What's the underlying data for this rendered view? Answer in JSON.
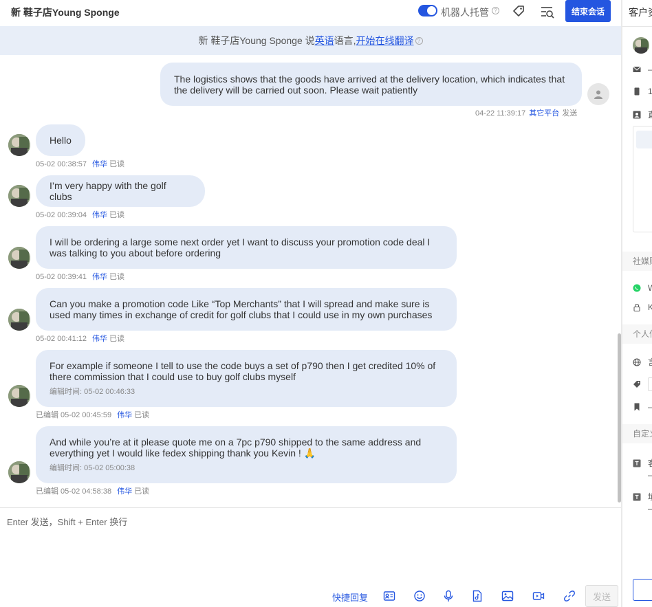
{
  "header": {
    "title": "新 鞋子店Young Sponge",
    "robot_label": "机器人托管",
    "help_glyph": "?",
    "end_button": "结束会话"
  },
  "notice": {
    "prefix": "新 鞋子店Young Sponge 说 ",
    "language": "英语",
    "middle": " 语言, ",
    "action": "开始在线翻译"
  },
  "messages": [
    {
      "direction": "out",
      "text": "The logistics shows that the goods have arrived at the delivery location, which indicates that the delivery will be carried out soon. Please wait patiently",
      "time": "04-22 11:39:17",
      "platform": "其它平台",
      "status": "发送"
    },
    {
      "direction": "in",
      "text": "Hello",
      "time": "05-02 00:38:57",
      "agent": "伟华",
      "status": "已读"
    },
    {
      "direction": "in",
      "text": "I’m very happy with the golf clubs",
      "time": "05-02 00:39:04",
      "agent": "伟华",
      "status": "已读"
    },
    {
      "direction": "in",
      "text": "I will be ordering a large some next order yet I want to discuss your promotion code deal I was talking to you about before ordering",
      "time": "05-02 00:39:41",
      "agent": "伟华",
      "status": "已读"
    },
    {
      "direction": "in",
      "text": "Can you make a promotion code Like “Top Merchants” that I will spread and make sure is used many times in exchange of credit for golf clubs that I could use in my own purchases",
      "time": "05-02 00:41:12",
      "agent": "伟华",
      "status": "已读"
    },
    {
      "direction": "in",
      "text": "For example if someone I tell to use the code buys a set of p790 then I get credited 10% of there commission that I could use to buy golf clubs myself",
      "edit_time": "编辑时间: 05-02 00:46:33",
      "time": "已编辑 05-02 00:45:59",
      "agent": "伟华",
      "status": "已读"
    },
    {
      "direction": "in",
      "text": "And while you’re at it please quote me on a 7pc p790 shipped to the same address and everything yet I would like fedex shipping thank you Kevin ! 🙏",
      "edit_time": "编辑时间: 05-02 05:00:38",
      "time": "已编辑 05-02 04:58:38",
      "agent": "伟华",
      "status": "已读"
    }
  ],
  "composer": {
    "placeholder": "Enter 发送，Shift + Enter 换行",
    "quick_reply": "快捷回复",
    "send": "发送"
  },
  "right_panel": {
    "title": "客户资",
    "rows": [
      "—",
      "1",
      "直"
    ],
    "section_social": "社媒账",
    "social_rows": [
      "W",
      "K"
    ],
    "section_personal": "个人信",
    "personal_rows": [
      "言",
      "",
      "—"
    ],
    "section_custom": "自定义",
    "custom_rows": [
      "客",
      "—",
      "填",
      "—"
    ]
  },
  "colors": {
    "accent": "#2456e0",
    "bubble": "#e4ebf7",
    "notice_bg": "#e8eef8"
  }
}
